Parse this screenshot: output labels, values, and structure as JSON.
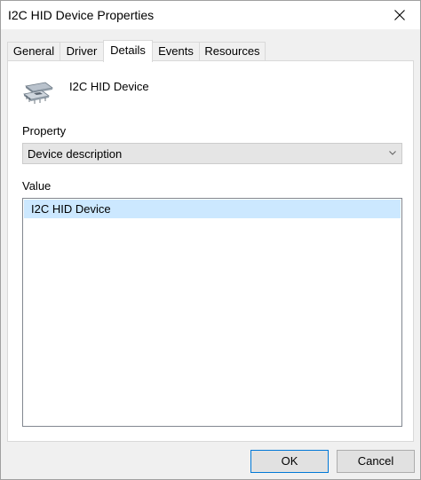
{
  "window": {
    "title": "I2C HID Device Properties",
    "close_icon": "close-icon"
  },
  "tabs": [
    {
      "label": "General",
      "active": false
    },
    {
      "label": "Driver",
      "active": false
    },
    {
      "label": "Details",
      "active": true
    },
    {
      "label": "Events",
      "active": false
    },
    {
      "label": "Resources",
      "active": false
    }
  ],
  "device": {
    "icon": "hid-device-icon",
    "name": "I2C HID Device"
  },
  "property": {
    "label": "Property",
    "selected": "Device description"
  },
  "value": {
    "label": "Value",
    "items": [
      "I2C HID Device"
    ]
  },
  "buttons": {
    "ok": "OK",
    "cancel": "Cancel"
  },
  "colors": {
    "selection": "#cce8ff",
    "focus_border": "#0078d7"
  }
}
